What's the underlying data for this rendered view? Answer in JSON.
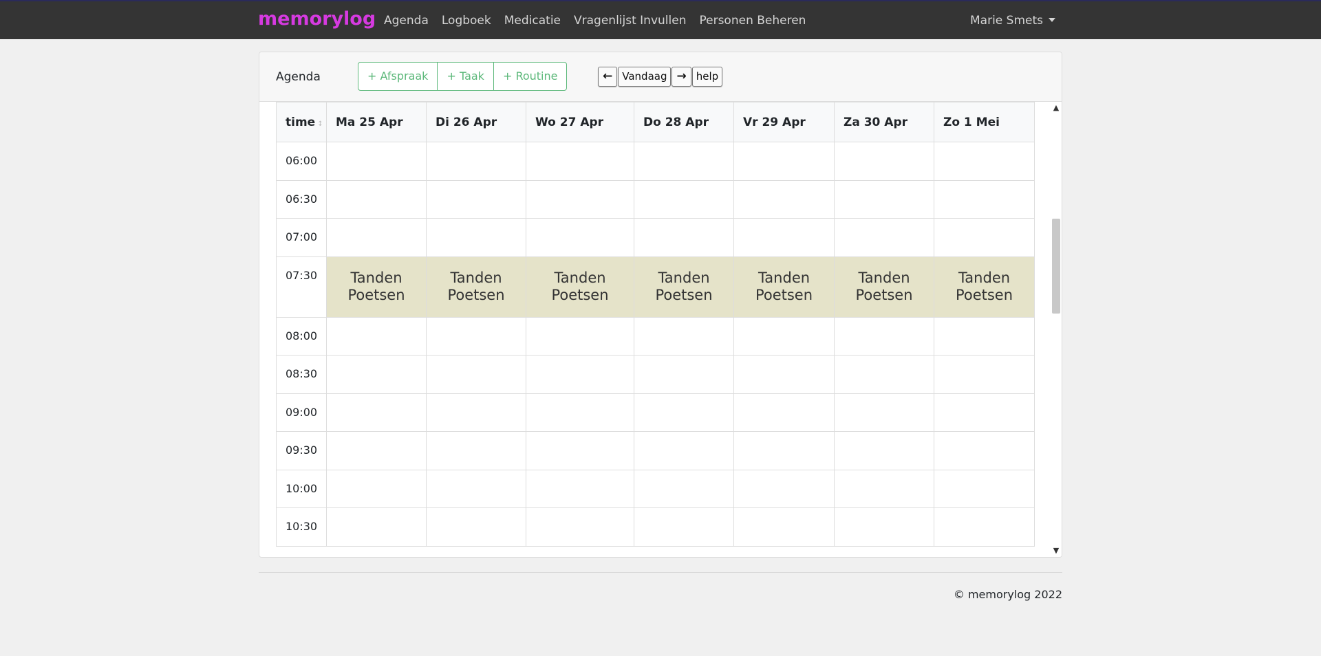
{
  "navbar": {
    "brand": "memorylog",
    "links": [
      "Agenda",
      "Logboek",
      "Medicatie",
      "Vragenlijst Invullen",
      "Personen Beheren"
    ],
    "user": "Marie Smets"
  },
  "agenda": {
    "title": "Agenda",
    "add_buttons": [
      "+ Afspraak",
      "+ Taak",
      "+ Routine"
    ],
    "prev_label": "🡐",
    "today_label": "Vandaag",
    "next_label": "🡒",
    "help_label": "help"
  },
  "calendar": {
    "time_header": "time",
    "days": [
      "Ma 25 Apr",
      "Di 26 Apr",
      "Wo 27 Apr",
      "Do 28 Apr",
      "Vr 29 Apr",
      "Za 30 Apr",
      "Zo 1 Mei"
    ],
    "slots": [
      "06:00",
      "06:30",
      "07:00",
      "07:30",
      "08:00",
      "08:30",
      "09:00",
      "09:30",
      "10:00",
      "10:30"
    ],
    "event_slot": "07:30",
    "event_title": "Tanden Poetsen"
  },
  "colors": {
    "navbar_bg": "#343434",
    "brand": "#d63ae0",
    "accent_green": "#5cb87a",
    "event_bg": "#e5e3c9"
  },
  "footer": {
    "copyright": "© memorylog 2022"
  }
}
